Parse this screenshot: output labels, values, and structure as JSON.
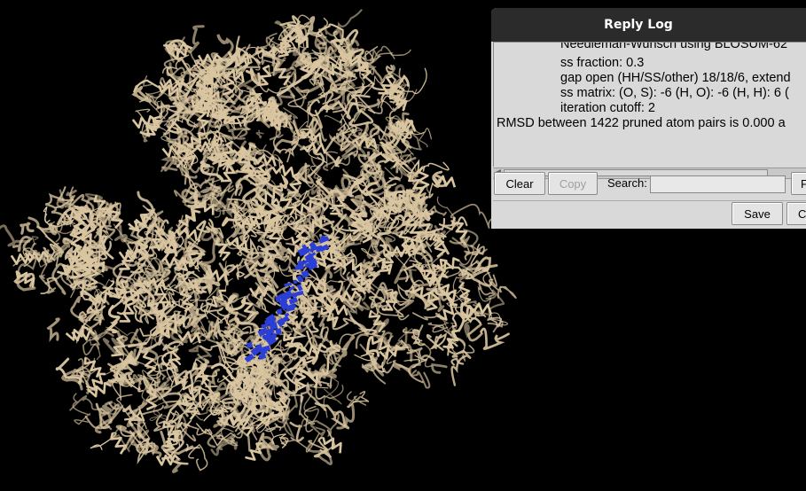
{
  "dialog": {
    "title": "Reply Log",
    "log_lines": [
      "Needleman-Wunsch using BLOSUM-62",
      "ss fraction: 0.3",
      "gap open (HH/SS/other) 18/18/6, extend",
      "ss matrix:  (O, S): -6 (H, O): -6 (H, H): 6 (",
      "iteration cutoff: 2",
      "RMSD between 1422 pruned atom pairs is 0.000 a"
    ],
    "buttons": {
      "clear": "Clear",
      "copy": "Copy",
      "find": "F",
      "save": "Save",
      "close": "C"
    },
    "search": {
      "label": "Search:",
      "value": ""
    }
  },
  "viewer": {
    "ribbon_color": "#d9c5a0",
    "highlight_color": "#2b3fd6",
    "background": "#000000"
  }
}
